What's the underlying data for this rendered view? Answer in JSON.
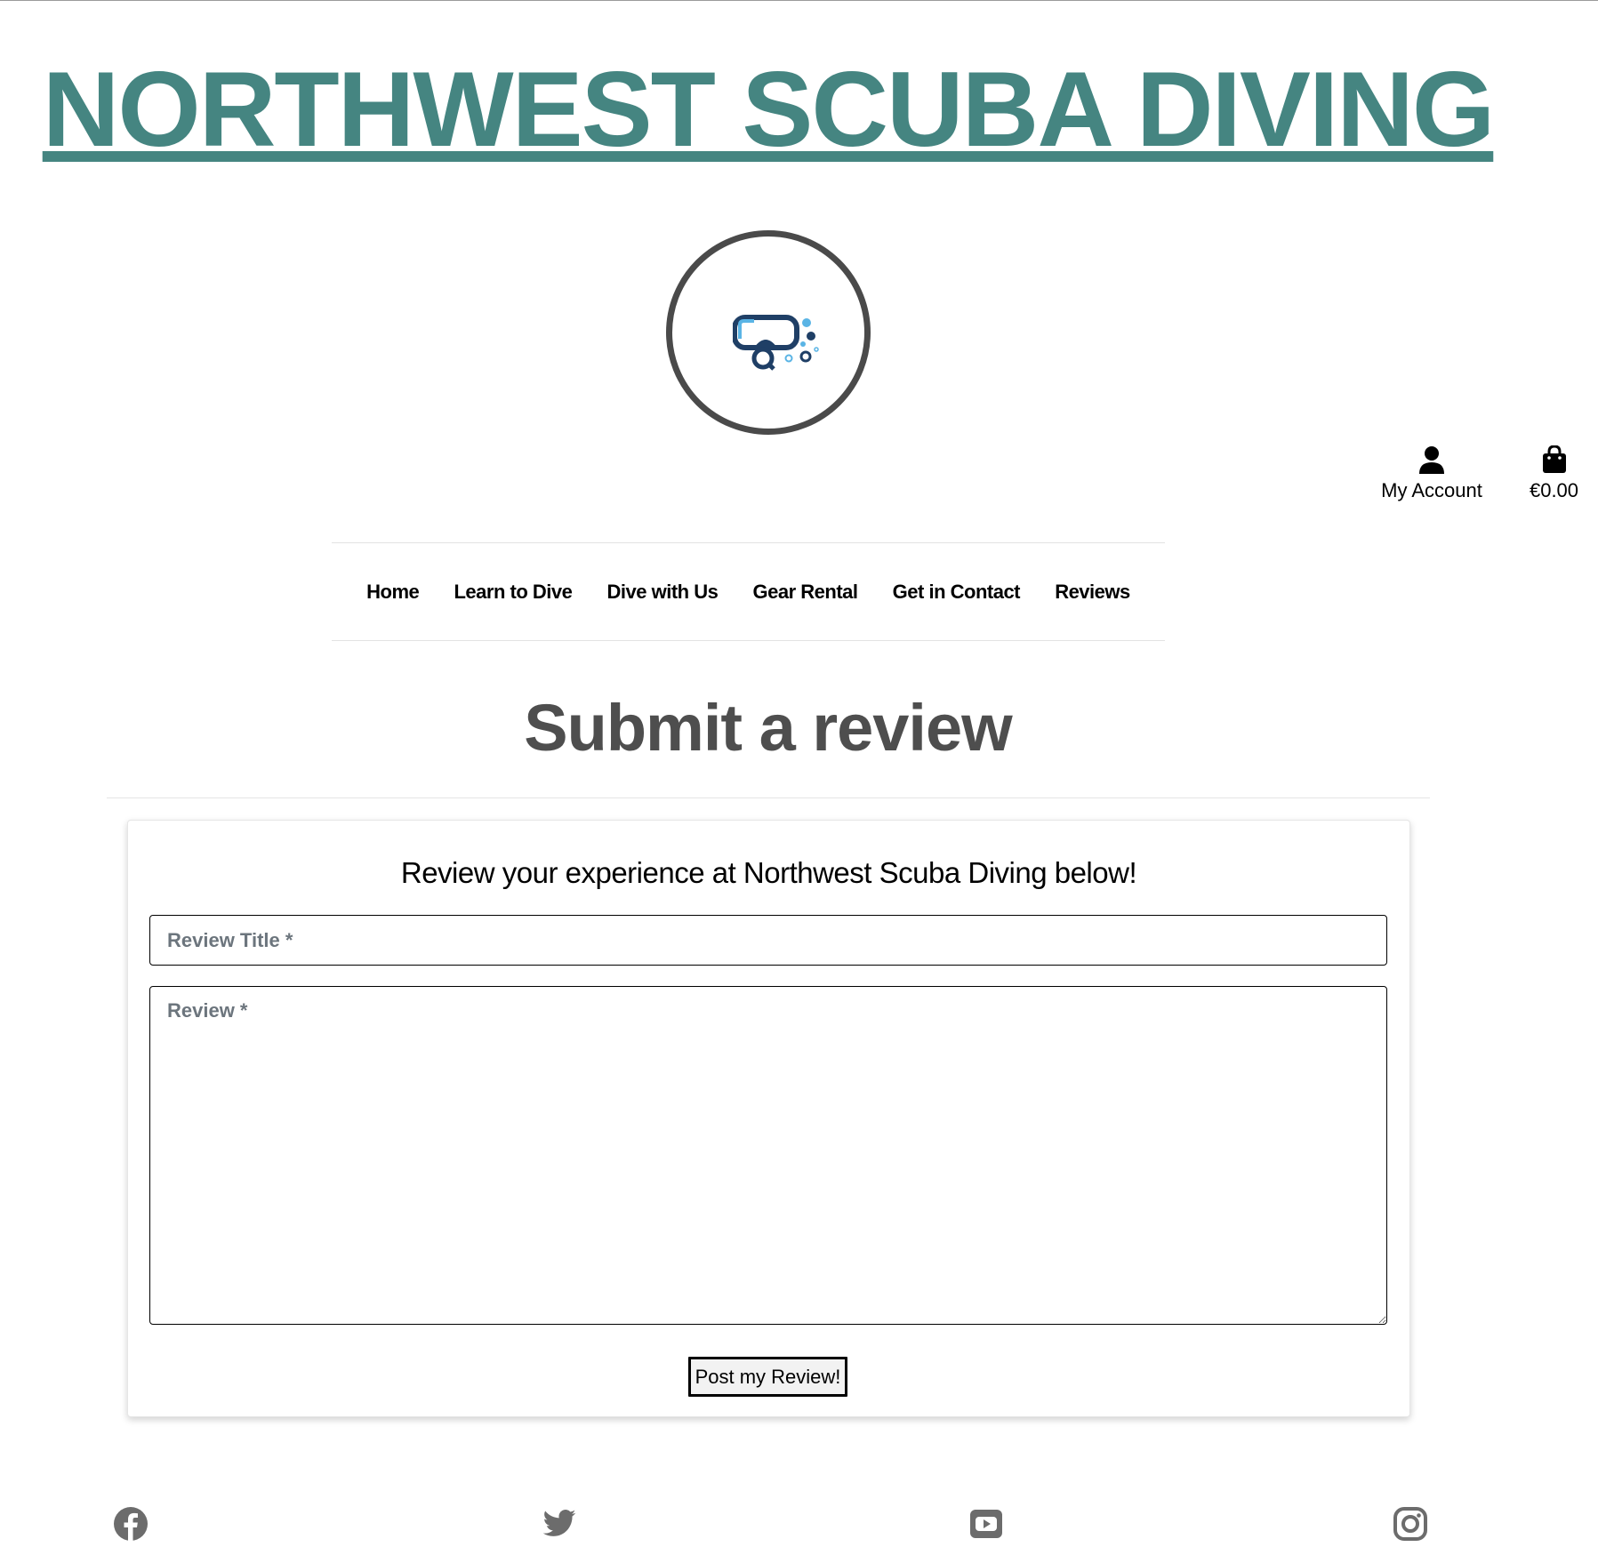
{
  "brand": {
    "title": "NORTHWEST SCUBA DIVING"
  },
  "header": {
    "account_label": "My Account",
    "bag_total": "€0.00"
  },
  "nav": {
    "items": [
      {
        "label": "Home"
      },
      {
        "label": "Learn to Dive"
      },
      {
        "label": "Dive with Us"
      },
      {
        "label": "Gear Rental"
      },
      {
        "label": "Get in Contact"
      },
      {
        "label": "Reviews"
      }
    ]
  },
  "page": {
    "title": "Submit a review"
  },
  "form": {
    "heading": "Review your experience at Northwest Scuba Diving below!",
    "title_placeholder": "Review Title *",
    "title_value": "",
    "review_placeholder": "Review *",
    "review_value": "",
    "submit_label": "Post my Review!"
  },
  "footer": {
    "socials": [
      "facebook-icon",
      "twitter-icon",
      "youtube-icon",
      "instagram-icon"
    ]
  },
  "colors": {
    "brand": "#458581",
    "heading": "#4e4e4e",
    "placeholder": "#6c757d",
    "icon_grey": "#6c6c6c",
    "logo_navy": "#1f3f66",
    "logo_light_blue": "#5ab4e5"
  }
}
